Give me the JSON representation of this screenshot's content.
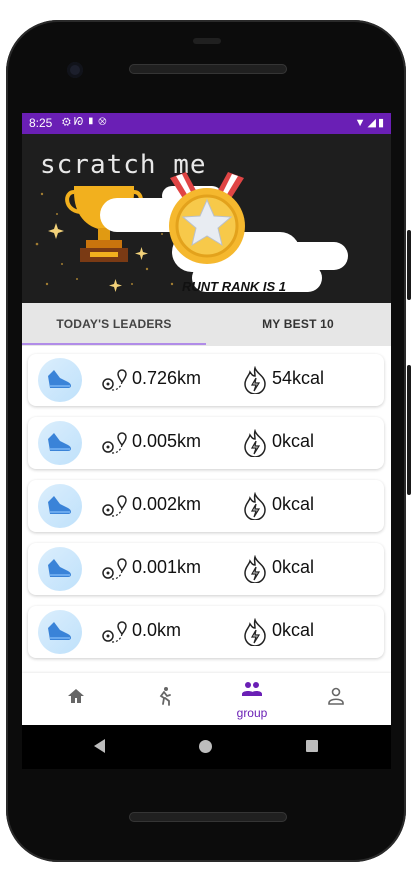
{
  "status_bar": {
    "time": "8:25",
    "left_icons": [
      "gear-icon",
      "nfc-icon",
      "sd-card-icon",
      "sync-icon"
    ],
    "right_icons": [
      "wifi-icon",
      "signal-icon",
      "battery-icon"
    ]
  },
  "banner": {
    "title": "scratch me",
    "rank_text": "RUNT RANK IS 1"
  },
  "tabs": [
    {
      "label": "TODAY'S LEADERS",
      "active": true
    },
    {
      "label": "MY BEST 10",
      "active": false
    }
  ],
  "leaders": [
    {
      "distance": "0.726km",
      "calories": "54kcal"
    },
    {
      "distance": "0.005km",
      "calories": "0kcal"
    },
    {
      "distance": "0.002km",
      "calories": "0kcal"
    },
    {
      "distance": "0.001km",
      "calories": "0kcal"
    },
    {
      "distance": "0.0km",
      "calories": "0kcal"
    }
  ],
  "bottom_nav": [
    {
      "icon": "home-icon"
    },
    {
      "icon": "run-icon"
    },
    {
      "icon": "group-icon",
      "label": "group",
      "active": true
    },
    {
      "icon": "person-icon"
    }
  ],
  "colors": {
    "accent": "#6a1fb5",
    "tab_indicator": "#b18ce8",
    "banner_bg": "#1e1e1e"
  }
}
